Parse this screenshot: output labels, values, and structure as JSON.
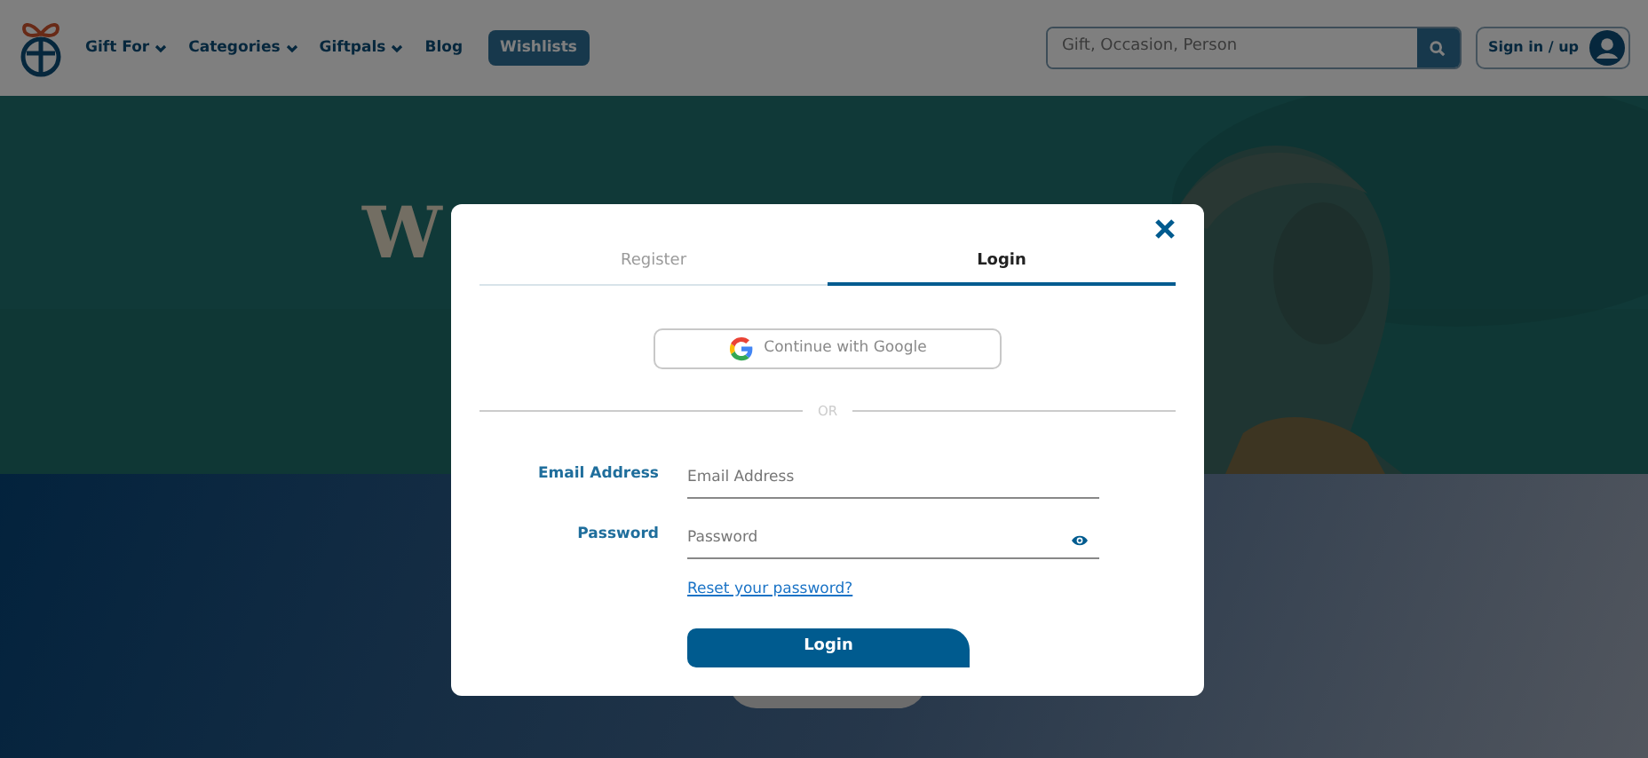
{
  "navbar": {
    "menu": [
      {
        "label": "Gift For",
        "dropdown": true
      },
      {
        "label": "Categories",
        "dropdown": true
      },
      {
        "label": "Giftpals",
        "dropdown": true
      },
      {
        "label": "Blog",
        "dropdown": false
      }
    ],
    "wishlists_button": "Wishlists",
    "search": {
      "placeholder": "Gift, Occasion, Person"
    },
    "sign_in": "Sign in / up"
  },
  "hero": {
    "kind": "picture",
    "heading": "W"
  },
  "modal": {
    "tabs": [
      {
        "label": "Register",
        "selected": false
      },
      {
        "label": "Login",
        "selected": true
      }
    ],
    "google_button": "Continue with Google",
    "divider": "OR",
    "fields": [
      {
        "label": "Email Address",
        "placeholder": "Email Address",
        "kind": "text"
      },
      {
        "label": "Password",
        "placeholder": "Password",
        "kind": "password"
      }
    ],
    "reset_link": "Reset your password?",
    "submit": "Login"
  }
}
